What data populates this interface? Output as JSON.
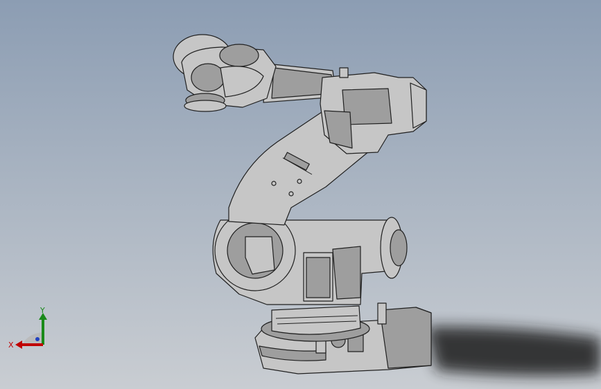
{
  "viewport": {
    "model": {
      "body_color": "#c6c6c6",
      "shade_color": "#9e9e9e",
      "edge_color": "#202020",
      "shadow_color": "#1e1e1e"
    },
    "triad": {
      "x_label": "X",
      "y_label": "Y",
      "x_color": "#c00000",
      "y_color": "#1a8a1a",
      "z_color": "#2040c0"
    }
  }
}
